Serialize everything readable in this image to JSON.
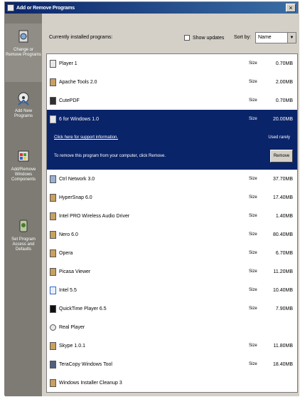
{
  "window": {
    "title": "Add or Remove Programs",
    "close_glyph": "×"
  },
  "sidebar": {
    "items": [
      {
        "label": "Change or Remove Programs",
        "icon": "cd-box-icon"
      },
      {
        "label": "Add New Programs",
        "icon": "cd-add-icon"
      },
      {
        "label": "Add/Remove Windows Components",
        "icon": "windows-components-icon"
      },
      {
        "label": "Set Program Access and Defaults",
        "icon": "program-access-icon"
      }
    ]
  },
  "toolbar": {
    "heading": "Currently installed programs:",
    "show_updates_label": "Show updates",
    "sort_label": "Sort by:",
    "sort_value": "Name"
  },
  "selected": {
    "name": "6 for Windows 1.0",
    "size_label": "Size",
    "size_value": "20.00MB",
    "support_link": "Click here for support information.",
    "used_label": "Used rarely",
    "description": "To remove this program from your computer, click Remove.",
    "remove_label": "Remove"
  },
  "programs": [
    {
      "name": "Player 1",
      "size_label": "Size",
      "size": "0.70MB"
    },
    {
      "name": "Apache Tools 2.0",
      "size_label": "Size",
      "size": "2.00MB"
    },
    {
      "name": "CutePDF",
      "size_label": "Size",
      "size": "0.70MB"
    },
    {
      "name": "Ctrl Network 3.0",
      "size_label": "Size",
      "size": "37.70MB"
    },
    {
      "name": "HyperSnap 6.0",
      "size_label": "Size",
      "size": "17.40MB"
    },
    {
      "name": "Intel PRO Wireless Audio Driver",
      "size_label": "Size",
      "size": "1.40MB"
    },
    {
      "name": "Nero 6.0",
      "size_label": "Size",
      "size": "80.40MB"
    },
    {
      "name": "Opera",
      "size_label": "Size",
      "size": "6.70MB"
    },
    {
      "name": "Picasa Viewer",
      "size_label": "Size",
      "size": "11.20MB"
    },
    {
      "name": "Intel 5.5",
      "size_label": "Size",
      "size": "10.40MB"
    },
    {
      "name": "QuickTime Player 6.5",
      "size_label": "Size",
      "size": "7.90MB"
    },
    {
      "name": "Real Player",
      "size_label": "",
      "size": ""
    },
    {
      "name": "Skype 1.0.1",
      "size_label": "Size",
      "size": "11.80MB"
    },
    {
      "name": "TeraCopy Windows Tool",
      "size_label": "Size",
      "size": "18.40MB"
    },
    {
      "name": "Windows Installer Cleanup 3",
      "size_label": "",
      "size": ""
    }
  ]
}
